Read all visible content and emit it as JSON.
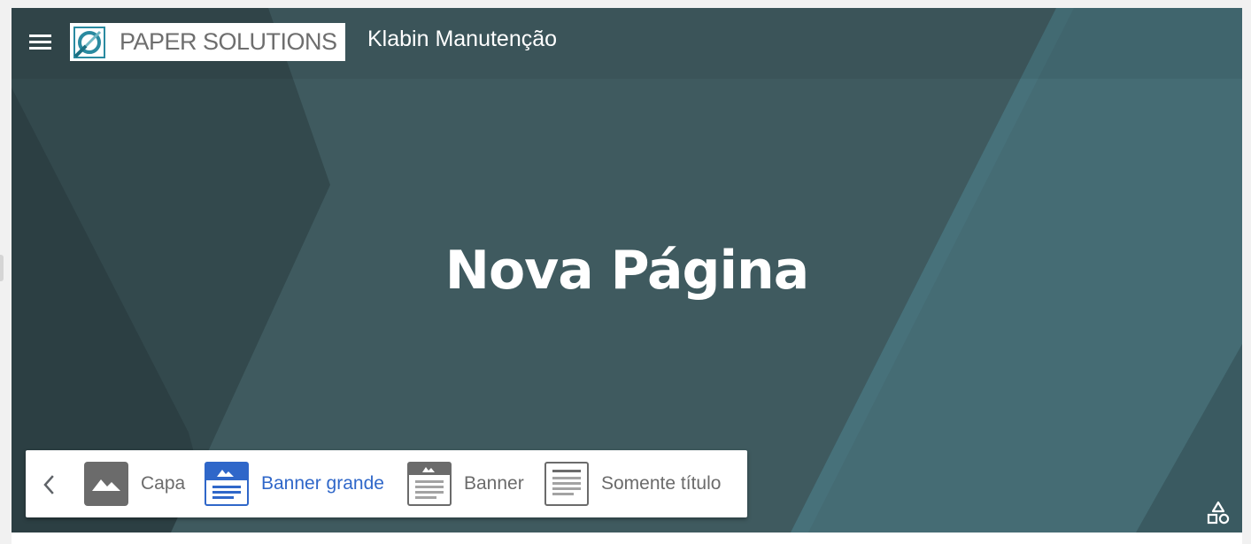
{
  "header": {
    "menu_icon": "hamburger-menu-icon",
    "logo_text": "PAPER SOLUTIONS",
    "site_title": "Klabin Manutenção"
  },
  "banner": {
    "page_title": "Nova Página",
    "colors": {
      "base": "#3f5a5f",
      "dark": "#2e4145",
      "teal": "#47717a"
    }
  },
  "layout_picker": {
    "back_icon": "chevron-left-icon",
    "options": [
      {
        "label": "Capa",
        "icon": "image-icon",
        "selected": false
      },
      {
        "label": "Banner grande",
        "icon": "large-banner-icon",
        "selected": true
      },
      {
        "label": "Banner",
        "icon": "banner-icon",
        "selected": false
      },
      {
        "label": "Somente título",
        "icon": "title-only-icon",
        "selected": false
      }
    ],
    "colors": {
      "selected": "#2f67c9",
      "default": "#6b6b6b"
    }
  },
  "theme_icon": "shapes-icon"
}
